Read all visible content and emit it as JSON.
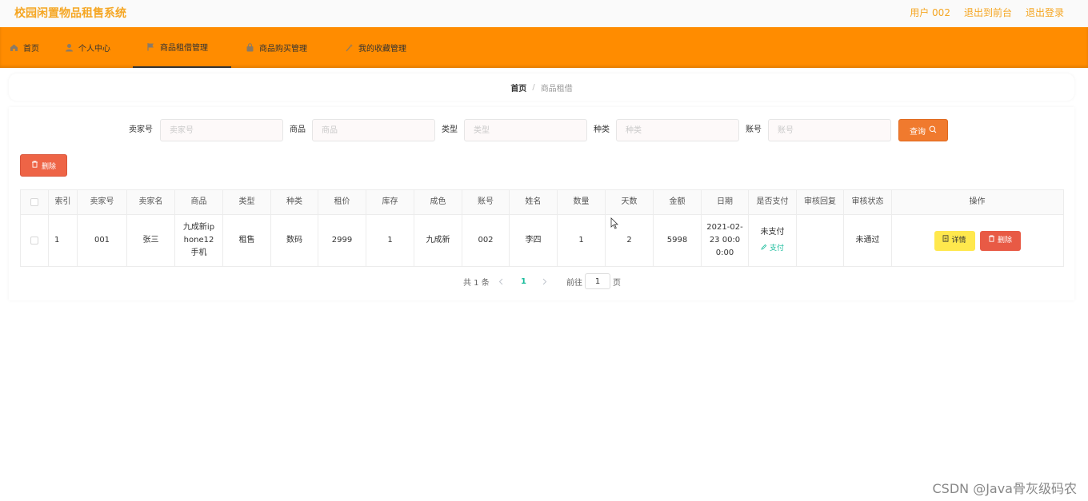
{
  "app": {
    "title": "校园闲置物品租售系统"
  },
  "top_links": {
    "user": "用户 002",
    "back_front": "退出到前台",
    "logout": "退出登录"
  },
  "nav": [
    {
      "label": "首页",
      "icon": "home-icon"
    },
    {
      "label": "个人中心",
      "icon": "user-icon"
    },
    {
      "label": "商品租借管理",
      "icon": "flag-icon"
    },
    {
      "label": "商品购买管理",
      "icon": "bag-icon"
    },
    {
      "label": "我的收藏管理",
      "icon": "magic-icon"
    }
  ],
  "breadcrumb": {
    "home": "首页",
    "separator": "/",
    "current": "商品租借"
  },
  "search": {
    "seller_no": {
      "label": "卖家号",
      "placeholder": "卖家号"
    },
    "product": {
      "label": "商品",
      "placeholder": "商品"
    },
    "type": {
      "label": "类型",
      "placeholder": "类型"
    },
    "category": {
      "label": "种类",
      "placeholder": "种类"
    },
    "account": {
      "label": "账号",
      "placeholder": "账号"
    },
    "query_label": "查询"
  },
  "toolbar": {
    "delete_label": "删除"
  },
  "table": {
    "headers": [
      "索引",
      "卖家号",
      "卖家名",
      "商品",
      "类型",
      "种类",
      "租价",
      "库存",
      "成色",
      "账号",
      "姓名",
      "数量",
      "天数",
      "金额",
      "日期",
      "是否支付",
      "审核回复",
      "审核状态",
      "操作"
    ],
    "rows": [
      {
        "index": "1",
        "seller_no": "001",
        "seller_name": "张三",
        "product": "九成新iphone12手机",
        "type": "租售",
        "category": "数码",
        "price": "2999",
        "stock": "1",
        "condition": "九成新",
        "account": "002",
        "name": "李四",
        "quantity": "1",
        "days": "2",
        "amount": "5998",
        "date": "2021-02-23 00:00:00",
        "paid": "未支付",
        "pay_action": "支付",
        "review_reply": "",
        "review_status": "未通过",
        "detail_label": "详情",
        "delete_label": "删除"
      }
    ]
  },
  "pagination": {
    "total": "共 1 条",
    "current_page": "1",
    "goto_label": "前往",
    "goto_value": "1",
    "page_suffix": "页"
  },
  "watermark": "CSDN @Java骨灰级码农",
  "colors": {
    "brand": "#f5a623",
    "nav_bg": "#ff8c00",
    "query_btn": "#f07a2e",
    "delete_btn": "#ee6446",
    "detail_btn": "#ffe84d",
    "link": "#1abc9c"
  }
}
